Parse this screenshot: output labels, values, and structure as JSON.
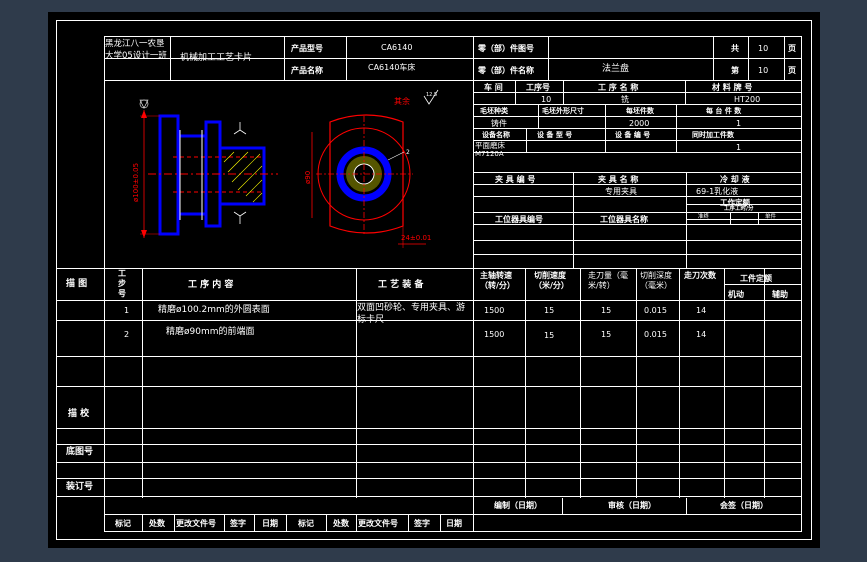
{
  "header": {
    "school": "黑龙江八一农垦大学05设计一班",
    "card_title": "机械加工工艺卡片",
    "product_model_label": "产品型号",
    "product_model": "CA6140",
    "product_name_label": "产品名称",
    "product_name": "CA6140车床",
    "part_no_label": "零（部）件图号",
    "part_no": "",
    "part_name_label": "零（部）件名称",
    "part_name": "法兰盘",
    "total_pages_label": "共",
    "total_pages": "10",
    "page_label": "第",
    "page_no": "10",
    "page_unit": "页"
  },
  "info": {
    "workshop_label": "车 间",
    "process_no_label": "工序号",
    "process_name_label": "工 序 名 称",
    "material_label": "材 料 牌 号",
    "process_no": "10",
    "process_name": "铣",
    "material": "HT200",
    "blank_type_label": "毛坯种类",
    "blank_size_label": "毛坯外形尺寸",
    "blank_count_label": "每坯件数",
    "per_unit_label": "每 台 件 数",
    "blank_type": "铸件",
    "blank_count": "2000",
    "per_unit": "1",
    "equip_name_label": "设备名称",
    "equip_model_label": "设 备 型 号",
    "equip_no_label": "设 备 编 号",
    "simul_label": "同时加工件数",
    "equip_name": "平面磨床",
    "equip_model": "M7120A",
    "simul": "1",
    "fixture_no_label": "夹 具 编 号",
    "fixture_name_label": "夹 具 名 称",
    "coolant_label": "冷 却 液",
    "fixture_name": "专用夹具",
    "coolant": "69-1乳化液",
    "time_quota_label": "工作定额",
    "station_tool_no_label": "工位器具编号",
    "station_tool_name_label": "工位器具名称",
    "single_label": "工序工时/分",
    "prep_label": "准终",
    "single2_label": "单件"
  },
  "drawing": {
    "other_label": "其余",
    "roughness": "12.5",
    "dim_left": "ø100±0.05",
    "dim_mid": "ø90",
    "dim_bottom": "24±0.01",
    "dim_small": "2"
  },
  "table": {
    "col_sketch": "描 图",
    "col_step": "工步号",
    "col_content": "工 序 内 容",
    "col_equipment": "工 艺 装 备",
    "col_speed": "主轴转速（转/分）",
    "col_cut_speed": "切削速度（米/分）",
    "col_feed": "走刀量（毫米/转）",
    "col_depth": "切削深度（毫米）",
    "col_passes": "走刀次数",
    "col_quota": "工件定额",
    "col_machine": "机动",
    "col_aux": "辅助",
    "equipment": "双面凹砂轮、专用夹具、游标卡尺",
    "rows": [
      {
        "step": "1",
        "content": "精磨ø100.2mm的外圆表面",
        "speed": "1500",
        "cut_speed": "15",
        "feed": "15",
        "depth": "0.015",
        "passes": "14"
      },
      {
        "step": "2",
        "content": "精磨ø90mm的前端面",
        "speed": "1500",
        "cut_speed": "15",
        "feed": "15",
        "depth": "0.015",
        "passes": "14"
      }
    ]
  },
  "left_labels": {
    "check": "描 校",
    "base_no": "底图号",
    "binding_no": "装订号"
  },
  "footer": {
    "compile": "编制（日期）",
    "review": "审核（日期）",
    "sign": "会签（日期）",
    "cols": [
      "标记",
      "处数",
      "更改文件号",
      "签字",
      "日期",
      "标记",
      "处数",
      "更改文件号",
      "签字",
      "日期"
    ]
  },
  "colors": {
    "line": "#ffffff",
    "part": "#0000ff",
    "section": "#ff0000",
    "hatch": "#ffff00",
    "dim": "#ff0000"
  }
}
